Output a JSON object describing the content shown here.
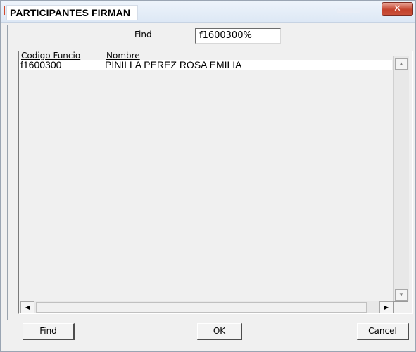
{
  "window": {
    "title": "PARTICIPANTES FIRMAN",
    "close_glyph": "✕"
  },
  "search": {
    "label": "Find",
    "value": "f1600300%"
  },
  "grid": {
    "columns": [
      "Codigo Funcio",
      "Nombre"
    ],
    "rows": [
      [
        "f1600300",
        "PINILLA PEREZ ROSA EMILIA"
      ]
    ]
  },
  "scrollbar": {
    "up_glyph": "▲",
    "down_glyph": "▼",
    "left_glyph": "◀",
    "right_glyph": "▶"
  },
  "buttons": {
    "find": "Find",
    "ok": "OK",
    "cancel": "Cancel"
  },
  "colors": {
    "window_bg": "#f0f0f0",
    "close_button": "#c4422c",
    "title_accent": "#d24a2d"
  }
}
